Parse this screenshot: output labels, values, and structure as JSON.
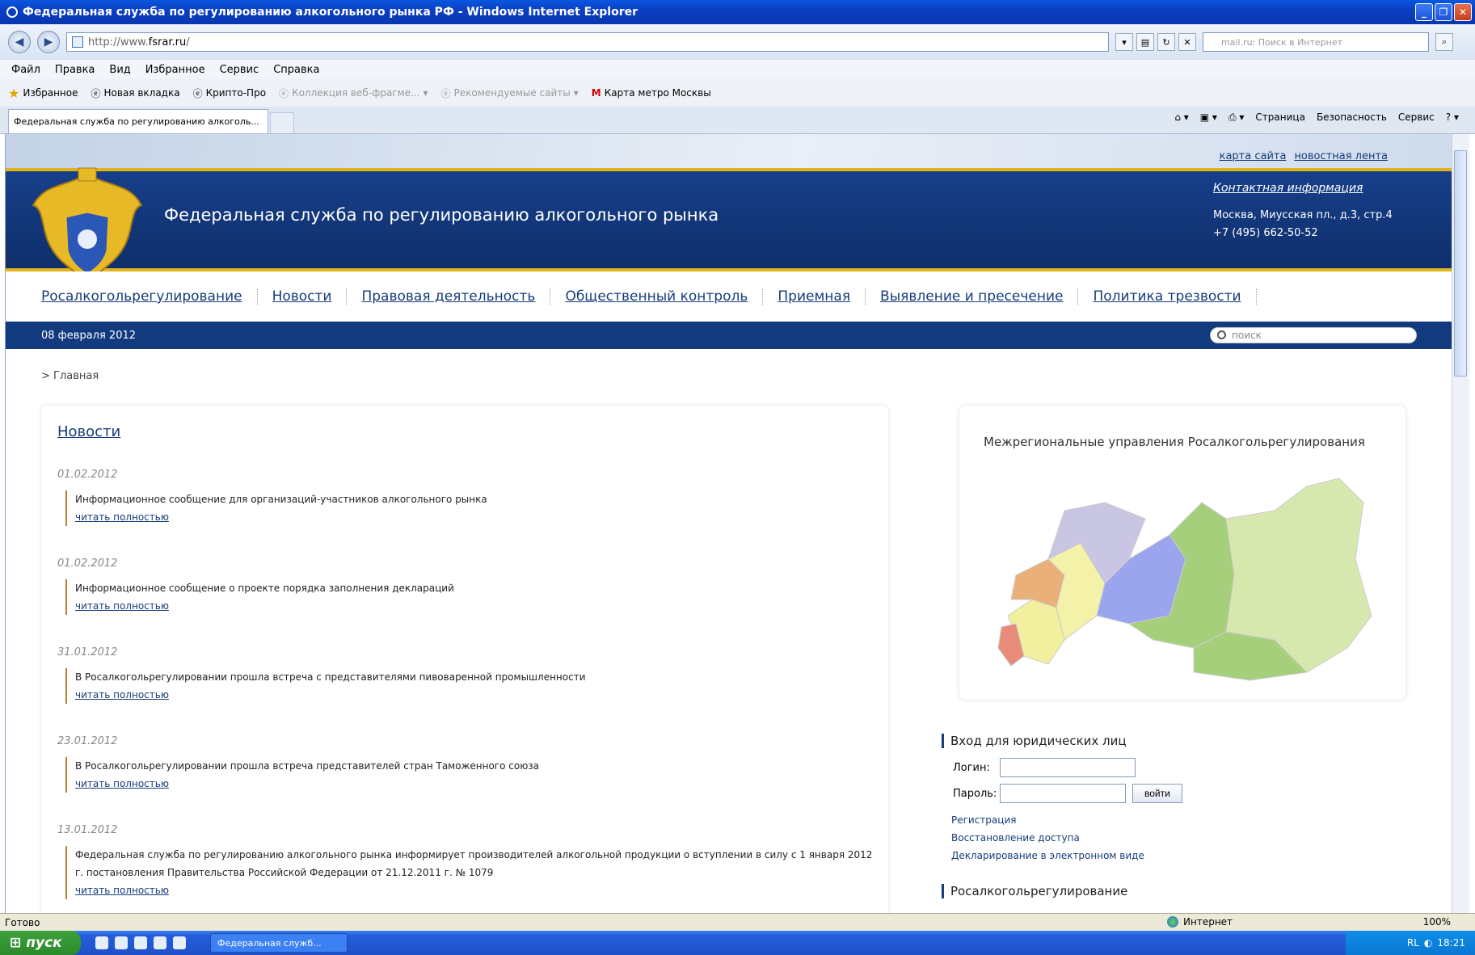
{
  "window": {
    "title": "Федеральная служба по регулированию алкогольного рынка РФ - Windows Internet Explorer"
  },
  "address": {
    "url_prefix": "http://www.",
    "url_domain": "fsrar.ru",
    "url_suffix": "/",
    "search_placeholder": "mail.ru: Поиск в Интернет"
  },
  "menu": [
    "Файл",
    "Правка",
    "Вид",
    "Избранное",
    "Сервис",
    "Справка"
  ],
  "favorites": {
    "label": "Избранное",
    "items": [
      {
        "label": "Новая вкладка",
        "dim": false
      },
      {
        "label": "Крипто-Про",
        "dim": false
      },
      {
        "label": "Коллекция веб-фрагме...",
        "dim": true
      },
      {
        "label": "Рекомендуемые сайты",
        "dim": true
      },
      {
        "label": "Карта метро Москвы",
        "dim": false
      }
    ]
  },
  "tab": {
    "label": "Федеральная служба по регулированию алкоголь..."
  },
  "commandbar": [
    "Страница",
    "Безопасность",
    "Сервис"
  ],
  "site": {
    "toplinks": [
      "карта сайта",
      "новостная лента"
    ],
    "title": "Федеральная служба по регулированию алкогольного рынка",
    "contact": {
      "heading": "Контактная информация",
      "address": "Москва, Миусская пл., д.3, стр.4",
      "phone": "+7 (495) 662-50-52"
    },
    "nav": [
      "Росалкогольрегулирование",
      "Новости",
      "Правовая деятельность",
      "Общественный контроль",
      "Приемная",
      "Выявление и пресечение",
      "Политика трезвости"
    ],
    "date": "08 февраля 2012",
    "search_placeholder": "поиск",
    "breadcrumb": "> Главная",
    "news": {
      "heading": "Новости",
      "more_label": "читать полностью",
      "items": [
        {
          "date": "01.02.2012",
          "text": "Информационное сообщение для организаций-участников алкогольного рынка"
        },
        {
          "date": "01.02.2012",
          "text": "Информационное сообщение о проекте порядка заполнения деклараций"
        },
        {
          "date": "31.01.2012",
          "text": "В Росалкогольрегулировании прошла встреча с представителями пивоваренной промышленности"
        },
        {
          "date": "23.01.2012",
          "text": "В Росалкогольрегулировании прошла встреча представителей стран Таможенного союза"
        },
        {
          "date": "13.01.2012",
          "text": "Федеральная служба по регулированию алкогольного рынка информирует производителей алкогольной продукции о вступлении в силу с 1 января 2012 г. постановления Правительства Российской Федерации от 21.12.2011 г. № 1079"
        }
      ]
    },
    "map": {
      "heading": "Межрегиональные управления Росалкогольрегулирования"
    },
    "login": {
      "heading": "Вход для юридических лиц",
      "login_label": "Логин:",
      "password_label": "Пароль:",
      "button": "войти",
      "links": [
        "Регистрация",
        "Восстановление доступа",
        "Декларирование в электронном виде"
      ]
    },
    "section2": "Росалкогольрегулирование"
  },
  "status": {
    "text": "Готово",
    "zone": "Интернет",
    "zoom": "100%"
  },
  "taskbar": {
    "start": "пуск",
    "task": "Федеральная служб...",
    "lang": "RL",
    "time": "18:21"
  }
}
